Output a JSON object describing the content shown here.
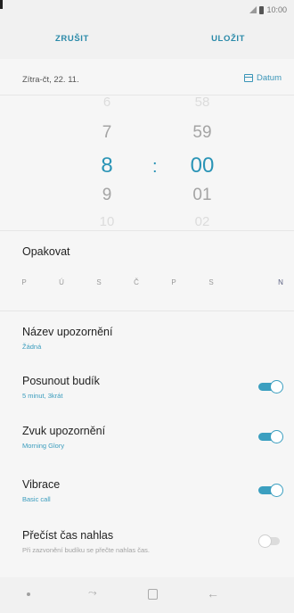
{
  "status_bar": {
    "time": "10:00"
  },
  "action_bar": {
    "cancel_label": "ZRUŠIT",
    "save_label": "ULOŽIT"
  },
  "date_row": {
    "date_text": "Zítra-čt, 22. 11.",
    "date_button_label": "Datum"
  },
  "time_picker": {
    "hours": [
      "6",
      "7",
      "8",
      "9",
      "10"
    ],
    "minutes": [
      "58",
      "59",
      "00",
      "01",
      "02"
    ],
    "selected_hour": "8",
    "selected_minute": "00",
    "separator": ":"
  },
  "repeat": {
    "title": "Opakovat",
    "days": [
      "P",
      "Ú",
      "S",
      "Č",
      "P",
      "S",
      "N"
    ]
  },
  "settings": [
    {
      "title": "Název upozornění",
      "subtitle": "Žádná"
    },
    {
      "title": "Posunout budík",
      "subtitle": "5 minut, 3krát",
      "enabled": true
    },
    {
      "title": "Zvuk upozornění",
      "subtitle": "Morning Glory",
      "enabled": true
    },
    {
      "title": "Vibrace",
      "subtitle": "Basic call",
      "enabled": true
    },
    {
      "title": "Přečíst čas nahlas",
      "subtitle": "Při zazvonění budíku se přečte nahlas čas.",
      "enabled": false
    }
  ],
  "colors": {
    "accent": "#2a94b6",
    "background": "#f6f6f6"
  },
  "icons": {
    "date": "calendar-icon",
    "nav": [
      "nav-dot-icon",
      "recent-apps-icon",
      "home-icon",
      "back-icon"
    ]
  }
}
